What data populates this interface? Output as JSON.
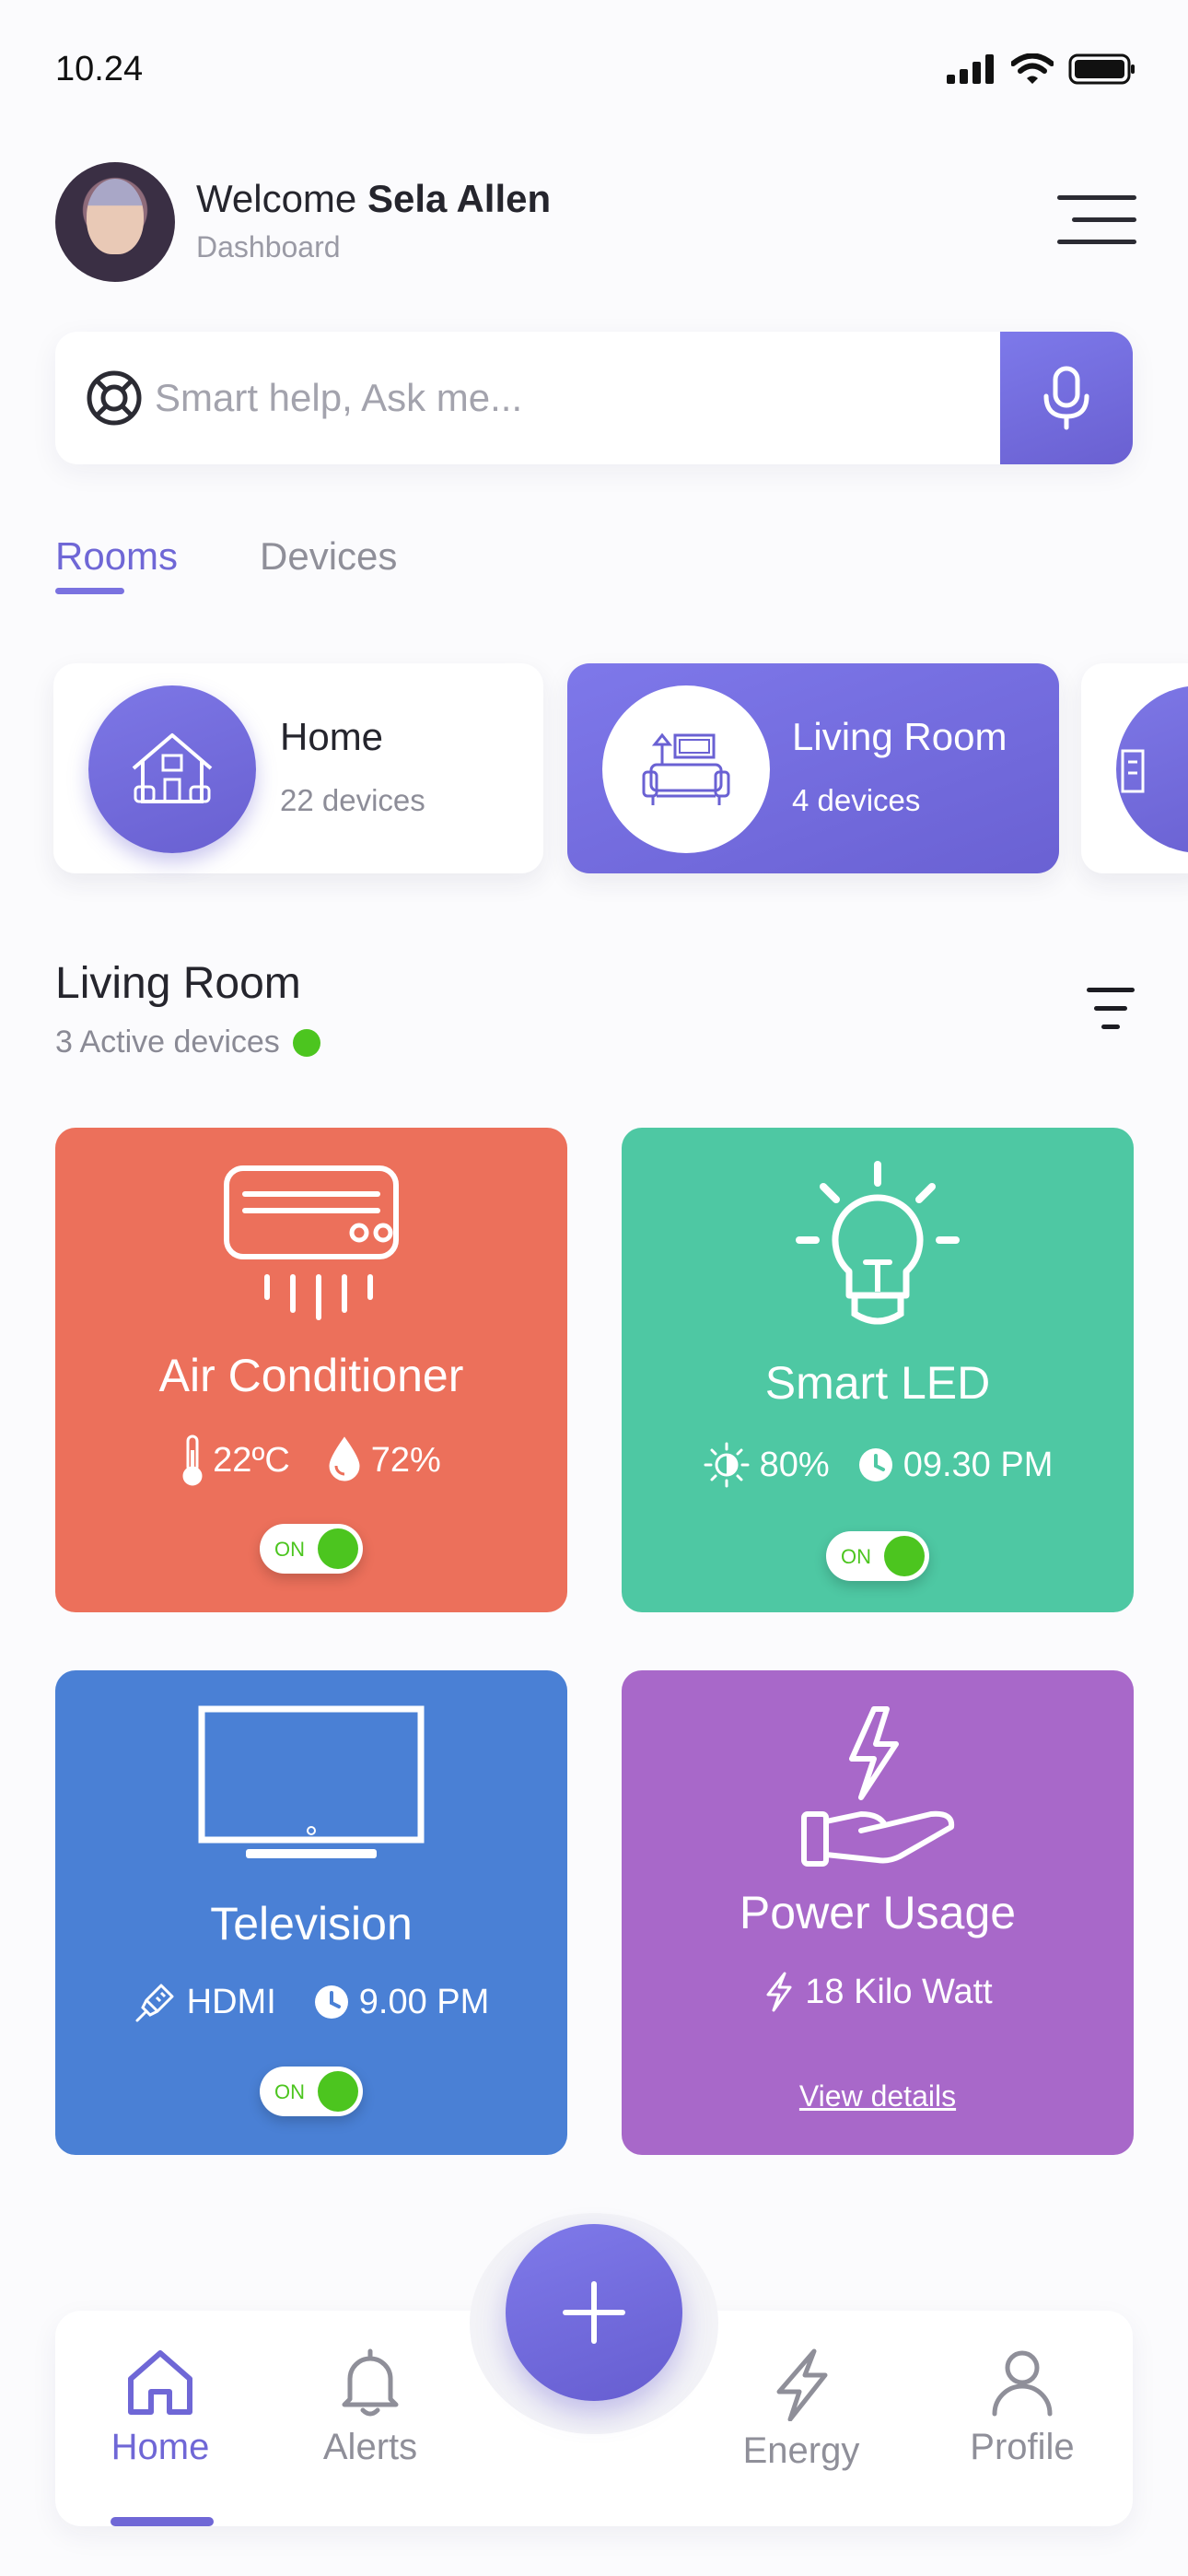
{
  "status_bar": {
    "time": "10.24"
  },
  "header": {
    "welcome_prefix": "Welcome ",
    "user_name": "Sela Allen",
    "subtitle": "Dashboard"
  },
  "search": {
    "placeholder": "Smart help, Ask me..."
  },
  "tabs": [
    {
      "label": "Rooms",
      "active": true
    },
    {
      "label": "Devices",
      "active": false
    }
  ],
  "rooms": [
    {
      "name": "Home",
      "count": "22 devices",
      "icon": "house-icon"
    },
    {
      "name": "Living Room",
      "count": "4 devices",
      "icon": "sofa-icon",
      "selected": true
    },
    {
      "icon": "building-icon"
    }
  ],
  "section": {
    "title": "Living Room",
    "subtitle": "3 Active devices"
  },
  "devices": {
    "ac": {
      "name": "Air Conditioner",
      "temperature": "22ºC",
      "humidity": "72%",
      "toggle": "ON"
    },
    "led": {
      "name": "Smart LED",
      "brightness": "80%",
      "time": "09.30 PM",
      "toggle": "ON"
    },
    "tv": {
      "name": "Television",
      "input": "HDMI",
      "time": "9.00 PM",
      "toggle": "ON"
    },
    "power": {
      "name": "Power Usage",
      "usage": "18 Kilo Watt",
      "link": "View details"
    }
  },
  "bottom_nav": [
    {
      "label": "Home",
      "icon": "home-icon",
      "active": true
    },
    {
      "label": "Alerts",
      "icon": "bell-icon"
    },
    {
      "label": "Energy",
      "icon": "bolt-icon"
    },
    {
      "label": "Profile",
      "icon": "user-icon"
    }
  ],
  "colors": {
    "accent": "#6f67d6",
    "ac_card": "#ec705b",
    "led_card": "#4ec8a3",
    "tv_card": "#4a80d5",
    "power_card": "#a868c9",
    "status_on": "#4cc51f"
  }
}
